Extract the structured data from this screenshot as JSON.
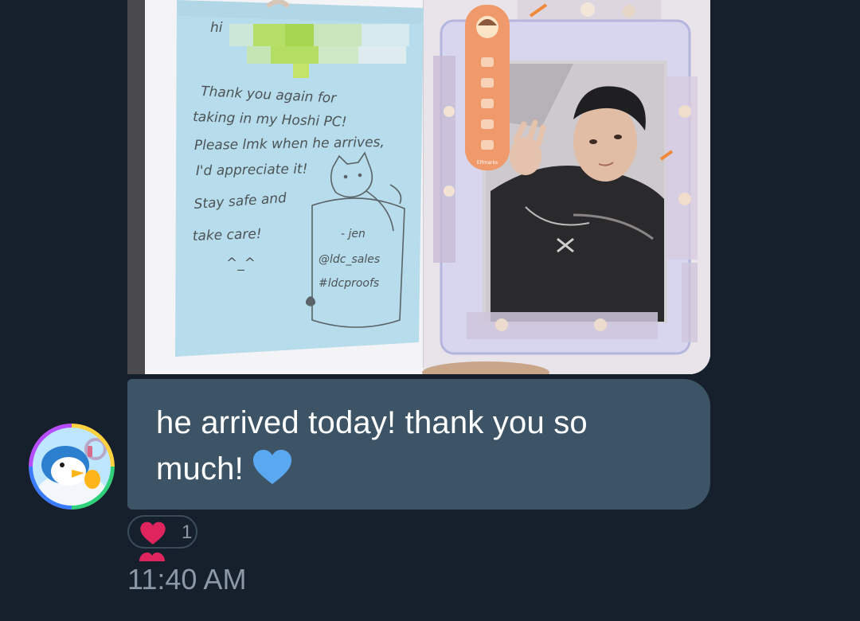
{
  "photo": {
    "note_lines": [
      "hi",
      "Thank you again for",
      "taking in my Hoshi PC!",
      "Please lmk when he arrives,",
      "I'd appreciate it!",
      "Stay safe and",
      "take care!",
      "^_^"
    ],
    "signature": [
      "- jen",
      "@ldc_sales",
      "#ldcproofs"
    ],
    "bookmark_brand": "Elfmarks"
  },
  "message": {
    "text": "he arrived today! thank you so much!",
    "emoji": "blue-heart"
  },
  "reaction": {
    "emoji": "red-heart",
    "count": "1"
  },
  "timestamp": "11:40 AM",
  "colors": {
    "background": "#16202c",
    "bubble": "#3d5466",
    "reaction_border": "#3a4b5a",
    "muted_text": "#8b98a5",
    "heart_red": "#e0245e",
    "heart_blue": "#5aa9f0"
  }
}
